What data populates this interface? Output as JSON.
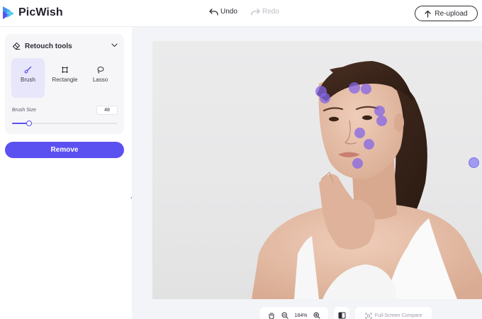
{
  "app": {
    "name": "PicWish",
    "brand_color": "#5b50f0"
  },
  "toolbar": {
    "undo_label": "Undo",
    "redo_label": "Redo",
    "reupload_label": "Re-upload"
  },
  "sidebar": {
    "panel_title": "Retouch tools",
    "tools": [
      {
        "label": "Brush",
        "icon": "brush-icon",
        "active": true
      },
      {
        "label": "Rectangle",
        "icon": "rectangle-select-icon",
        "active": false
      },
      {
        "label": "Lasso",
        "icon": "lasso-icon",
        "active": false
      }
    ],
    "brush_size_label": "Brush Size",
    "brush_size_value": "48",
    "brush_size_fraction": 0.16,
    "remove_label": "Remove"
  },
  "canvas": {
    "image": "portrait of a woman with hand under chin, marked blemish spots",
    "zoom_label": "184%",
    "fullscreen_compare_label": "Full-Screen Compare"
  }
}
